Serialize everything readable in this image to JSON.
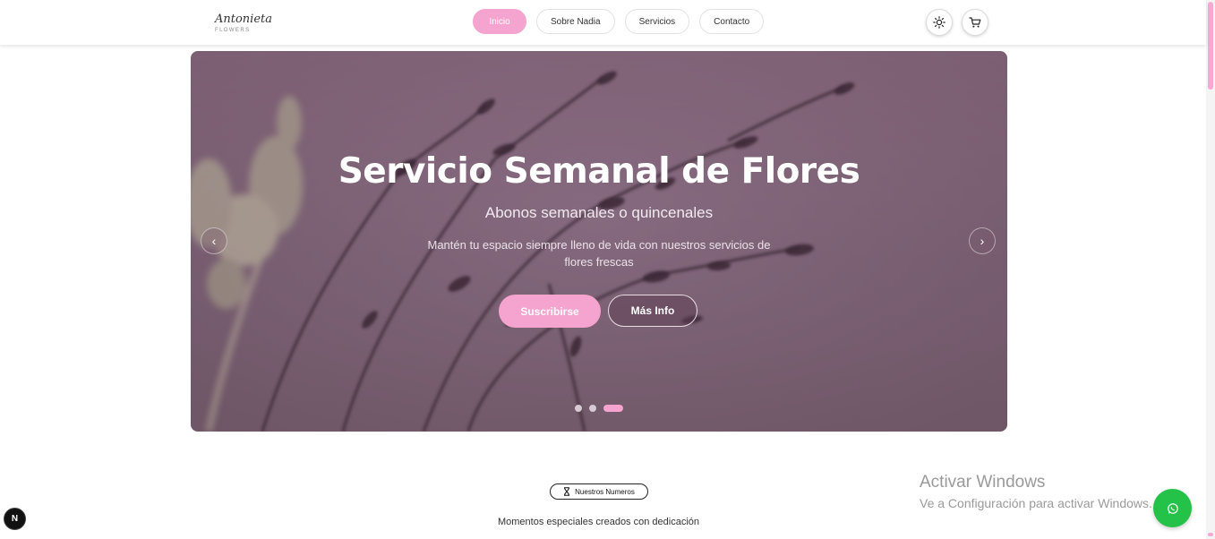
{
  "brand": {
    "name": "Antonieta",
    "sub": "FLOWERS"
  },
  "nav": {
    "items": [
      {
        "label": "Inicio",
        "active": true
      },
      {
        "label": "Sobre Nadia"
      },
      {
        "label": "Servicios"
      },
      {
        "label": "Contacto"
      }
    ]
  },
  "header_icons": {
    "theme": "sun-icon",
    "cart": "cart-icon"
  },
  "hero": {
    "title": "Servicio Semanal de Flores",
    "subtitle": "Abonos semanales o quincenales",
    "description": "Mantén tu espacio siempre lleno de vida con nuestros servicios de flores frescas",
    "primary_button": "Suscribirse",
    "secondary_button": "Más Info",
    "prev_arrow": "‹",
    "next_arrow": "›",
    "slides_total": 3,
    "active_slide": 3
  },
  "stats": {
    "badge": "Nuestros Numeros",
    "badge_icon": "hourglass-icon",
    "caption": "Momentos especiales creados con dedicación"
  },
  "watermark": {
    "title": "Activar Windows",
    "subtitle": "Ve a Configuración para activar Windows."
  },
  "next_badge": {
    "label": "N"
  },
  "colors": {
    "accent": "#f5a3cf",
    "hero_bg": "#7f6478",
    "whatsapp": "#25c24a"
  }
}
